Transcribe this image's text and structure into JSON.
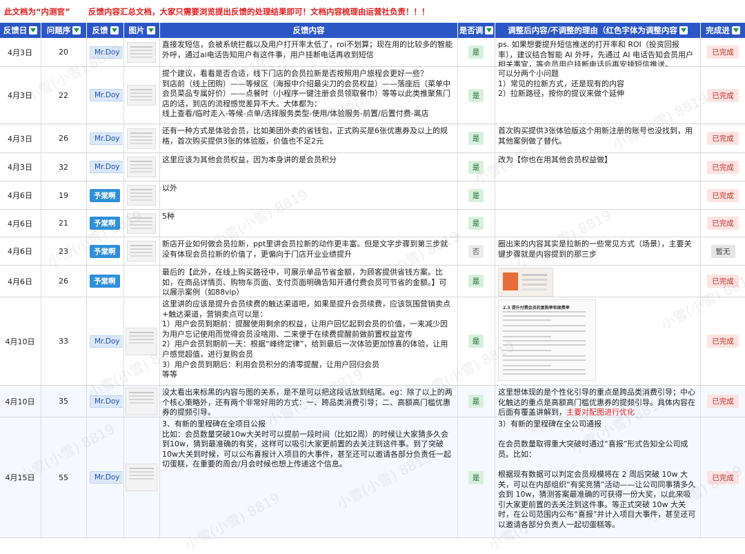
{
  "banner": {
    "left": "此文档为“内测官”",
    "right": "反馈内容汇总文档，大家只需要浏览提出反馈的处理结果即可！文档内容梳理由运营社负责！！！"
  },
  "headers": {
    "date": "反馈日",
    "num": "问题序",
    "user": "反馈",
    "img": "图片",
    "content": "反馈内容",
    "yn": "是否调",
    "reason": "调整后内容/不调整的理由（红色字体为调整内容",
    "status": "完成进"
  },
  "watermark": "小雪(小雪) 8819",
  "rows": [
    {
      "date": "4月3日",
      "num": "20",
      "user": "Mr.Doy",
      "content": "直接发短信，会被系统拦截以及用户打开率太低了，roi不划算；现在用的比较多的智能外呼，通过ai电话告知用户有这件事，用户挂断电话再收到短信",
      "yn": "是",
      "reason": "ps. 如果想要提升短信推送的打开率和 ROI（投资回报率），建议结合智能 AI 外呼，先通过 AI 电话告知会员用户相关事宜，等会员用户挂断电话后再安排短信推送。",
      "reason_red": "",
      "status": "已完成"
    },
    {
      "date": "4月3日",
      "num": "22",
      "user": "Mr.Doy",
      "content": "提个建议，看看是否合适，线下门店的会员拉新是否按照用户旅程会更好一些？\n到店前（线上团购）——等候区（海报中介绍最尖刀的会员权益）——落座后（菜单中会员菜品专属好价）——点餐时（小程序一键注册会员领取餐巾）等等以此类推聚焦门店的话，到店的流程感觉差异不大。大体都为：\n线上查看/临时走入-等候-点单/选择服务类型-使用/体验服务-前置/后置付费-离店",
      "yn": "是",
      "reason": "可以分两个小问题\n1）常见的拉新方式，还是现有的内容\n2）拉新路径，按你的提议来做个延伸",
      "reason_red": "",
      "status": "已完成"
    },
    {
      "date": "4月3日",
      "num": "26",
      "user": "Mr.Doy",
      "content": "还有一种方式是体验会员，比如美团外卖的省钱包，正式购买是6张优惠券及以上的规格，首次购买提供3张的体验版，价值也不足2元",
      "yn": "是",
      "reason": "首次购买提供3张体验版这个用新注册的账号也没找到，用其他案例做了替代。",
      "reason_red": "",
      "status": "已完成"
    },
    {
      "date": "4月3日",
      "num": "32",
      "user": "Mr.Doy",
      "content": "这里应该为其他会员权益，因为本身讲的是会员积分",
      "yn": "是",
      "reason": "改为【你也在用其他会员权益做】",
      "reason_red": "",
      "status": "已完成"
    },
    {
      "date": "4月6日",
      "num": "19",
      "user": "予棠啊",
      "content": "以外",
      "yn": "是",
      "reason": "",
      "reason_red": "",
      "status": "已完成"
    },
    {
      "date": "4月6日",
      "num": "21",
      "user": "予棠啊",
      "content": "5种",
      "yn": "是",
      "reason": "",
      "reason_red": "",
      "status": "已完成"
    },
    {
      "date": "4月6日",
      "num": "23",
      "user": "予棠啊",
      "content": "新店开业如何做会员拉新，ppt里讲会员拉新的动作更丰富。但是文字步骤到第三步就没有体现会员拉新的价值了，更偏向于门店开业业绩提升",
      "yn": "否",
      "reason": "圈出来的内容其实是拉新的一些常见方式（场景），主要关键步骤就是内容提到的那三步",
      "reason_red": "",
      "status": "暂无"
    },
    {
      "date": "4月6日",
      "num": "26",
      "user": "予棠啊",
      "content": "最后的【此外，在线上购买路径中，可展示单品节省金额，为顾客提供省钱方案。比如，在商品详情页、购物车页面、支付页面明确告知开通付费会员可节省的金额。】可以展示案例（如88vip）",
      "yn": "是",
      "reason": "",
      "reason_red": "",
      "status": "已完成"
    },
    {
      "date": "4月10日",
      "num": "33",
      "user": "Mr.Doy",
      "content": "这里讲的应该是提升会员续费的触达渠道吧，如果是提升会员续费，应该氛围营销卖点+触达渠道，营销卖点可以是：\n1）用户会员到期前：提醒使用剩余的权益，让用户回忆起到会员的价值，一来减少因为用户忘记使用而觉得会员没啥用、二来便于在续费提醒前做前置权益宣传\n2）用户会员到期前一天：根据“峰终定律”，给到最后一次体验更加惊喜的体验，让用户感觉超值，进行复购会员\n3）用户会员到期后：利用会员积分的清零提醒，让用户回归会员\n等等",
      "yn": "是",
      "reason": "",
      "reason_red": "",
      "status": "已完成",
      "img_title": "2.3 提升付费会员的复购率和续费率"
    },
    {
      "date": "4月10日",
      "num": "35",
      "user": "Mr.Doy",
      "content": "没太看出来标黑的内容与图的关系，是不是可以把这段话放到结尾。eg：除了以上的两个核心策略外，还有两个非常好用的方式：一、跨品类消费引导；二、高额高门槛优惠券的提频引导。",
      "yn": "是",
      "reason": "这里想体现的是个性化引导的重点是跨品类消费引导；中心化触达的重点是高额高门槛优惠券的提频引导。具体内容在后面有覆盖讲解到，",
      "reason_red": "主要对配图进行优化",
      "status": "已完成"
    },
    {
      "date": "4月15日",
      "num": "55",
      "user": "Mr.Doy",
      "content": "3、有新的里程碑在全项目公报\n比如：会员数量突破10w大关时可以提前一段时间（比如2周）的时候让大家猜多久会到10w，猜到最准确的有奖，这样可以吸引大家更前置的去关注到这件事。到了突破10w大关到时候，可以公布喜报计入项目的大事件，甚至还可以邀请各部分负责任一起切蛋糕，在重要的周会/月会时候也想上传递这个信息。",
      "yn": "是",
      "reason": "3）有新的里程碑在全公司通报\n\n在会员数量取得重大突破时通过“喜报”形式告知全公司成员。比如：\n\n根据现有数据可以判定会员规模将在 2 周后突破 10w 大关，可以在内部组织“有奖竞猜”活动——让公司同事猜多久会到 10w，猜测答案最准确的可获得一份大奖，以此来吸引大家更前置的去关注到这件事。等正式突破 10w 大关时，在公司范围内公布“喜报”并计入项目大事件，甚至还可以邀请各部分负责人一起切蛋糕等。",
      "reason_red": "",
      "status": "已完成"
    }
  ]
}
